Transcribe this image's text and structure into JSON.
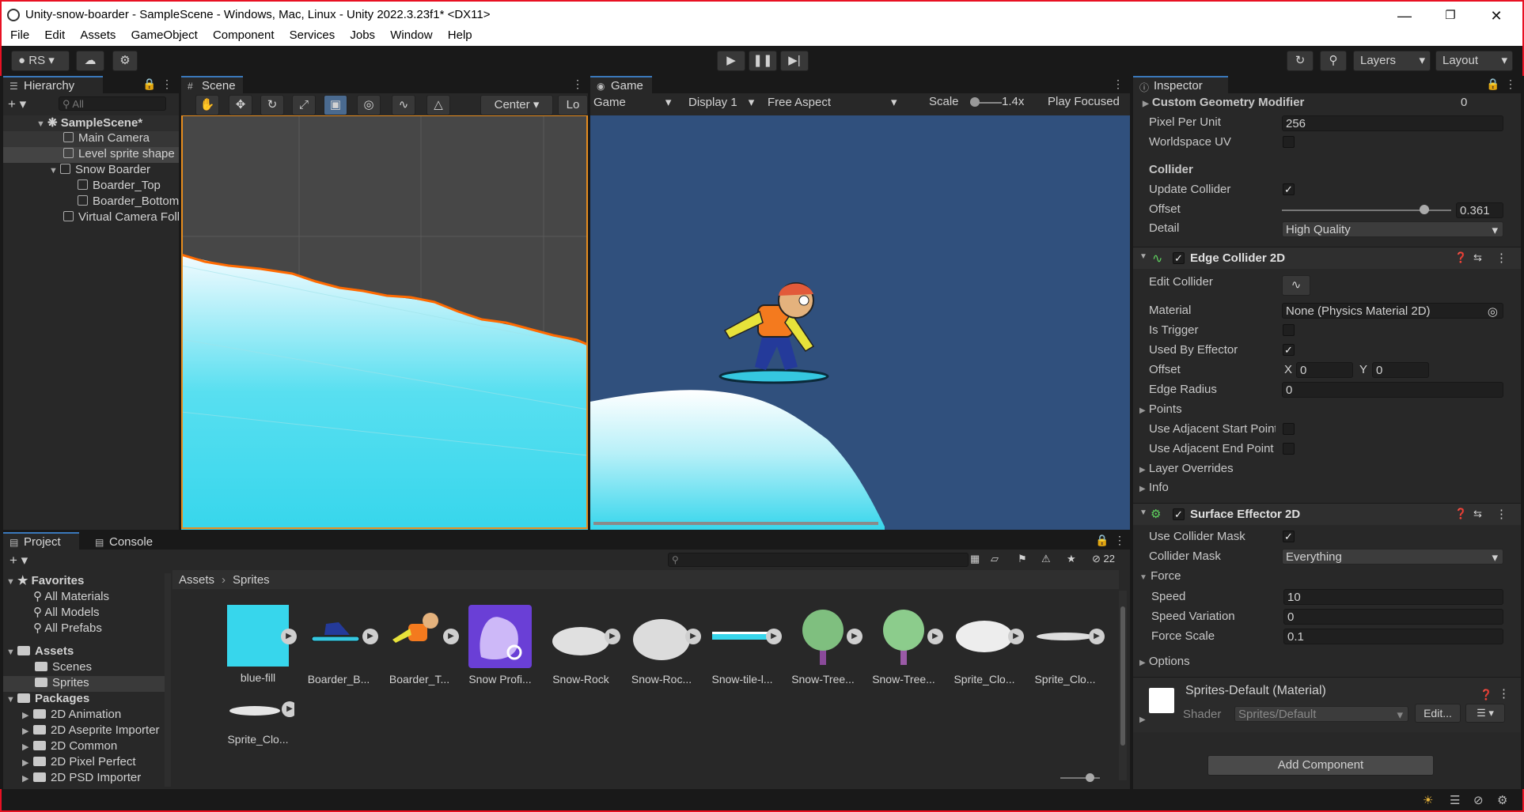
{
  "window": {
    "title": "Unity-snow-boarder - SampleScene - Windows, Mac, Linux - Unity 2022.3.23f1* <DX11>"
  },
  "menu": [
    "File",
    "Edit",
    "Assets",
    "GameObject",
    "Component",
    "Services",
    "Jobs",
    "Window",
    "Help"
  ],
  "toolbar": {
    "account": "RS",
    "layers": "Layers",
    "layout": "Layout"
  },
  "hierarchy": {
    "tab": "Hierarchy",
    "search_placeholder": "All",
    "scene": "SampleScene*",
    "items": [
      "Main Camera",
      "Level sprite shape",
      "Snow Boarder",
      "Boarder_Top",
      "Boarder_Bottom",
      "Virtual Camera Follow"
    ]
  },
  "scene": {
    "tab": "Scene",
    "pivot": "Center",
    "local": "Lo"
  },
  "game": {
    "tab": "Game",
    "mode": "Game",
    "display": "Display 1",
    "aspect": "Free Aspect",
    "scale_label": "Scale",
    "scale_value": "1.4x",
    "play_focused": "Play Focused"
  },
  "inspector": {
    "tab": "Inspector",
    "custom_geometry": "Custom Geometry Modifier",
    "custom_geometry_val": "0",
    "pixel_per_unit": "Pixel Per Unit",
    "pixel_per_unit_val": "256",
    "worldspace_uv": "Worldspace UV",
    "collider_section": "Collider",
    "update_collider": "Update Collider",
    "offset": "Offset",
    "offset_val": "0.361",
    "detail": "Detail",
    "detail_val": "High Quality",
    "edge_collider": "Edge Collider 2D",
    "edit_collider": "Edit Collider",
    "material": "Material",
    "material_val": "None (Physics Material 2D)",
    "is_trigger": "Is Trigger",
    "used_by_effector": "Used By Effector",
    "offset2": "Offset",
    "x_label": "X",
    "x_val": "0",
    "y_label": "Y",
    "y_val": "0",
    "edge_radius": "Edge Radius",
    "edge_radius_val": "0",
    "points": "Points",
    "adj_start": "Use Adjacent Start Point",
    "adj_end": "Use Adjacent End Point",
    "layer_overrides": "Layer Overrides",
    "info": "Info",
    "surface_effector": "Surface Effector 2D",
    "use_collider_mask": "Use Collider Mask",
    "collider_mask": "Collider Mask",
    "collider_mask_val": "Everything",
    "force": "Force",
    "speed": "Speed",
    "speed_val": "10",
    "speed_variation": "Speed Variation",
    "speed_variation_val": "0",
    "force_scale": "Force Scale",
    "force_scale_val": "0.1",
    "options": "Options",
    "material_name": "Sprites-Default (Material)",
    "shader": "Shader",
    "shader_val": "Sprites/Default",
    "edit_btn": "Edit...",
    "add_component": "Add Component"
  },
  "project": {
    "tab_project": "Project",
    "tab_console": "Console",
    "hidden_count": "22",
    "favorites": "Favorites",
    "fav_items": [
      "All Materials",
      "All Models",
      "All Prefabs"
    ],
    "assets": "Assets",
    "asset_folders": [
      "Scenes",
      "Sprites"
    ],
    "packages": "Packages",
    "package_items": [
      "2D Animation",
      "2D Aseprite Importer",
      "2D Common",
      "2D Pixel Perfect",
      "2D PSD Importer"
    ],
    "breadcrumb": [
      "Assets",
      "Sprites"
    ],
    "files": [
      "blue-fill",
      "Boarder_B...",
      "Boarder_T...",
      "Snow Profi...",
      "Snow-Rock",
      "Snow-Roc...",
      "Snow-tile-l...",
      "Snow-Tree...",
      "Snow-Tree...",
      "Sprite_Clo...",
      "Sprite_Clo...",
      "Sprite_Clo..."
    ]
  },
  "colors": {
    "accent": "#3a79bb",
    "game_bg": "#30507d",
    "snow": "#37d6ec",
    "terrain_edge": "#ff6a00"
  }
}
